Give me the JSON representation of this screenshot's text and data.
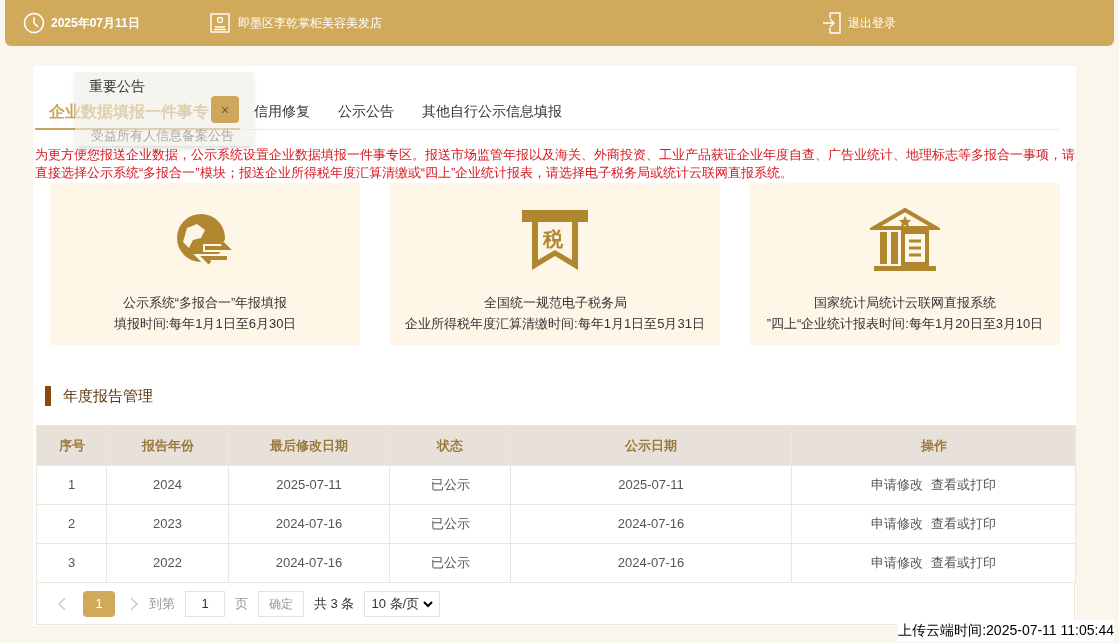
{
  "header": {
    "date": "2025年07月11日",
    "shop": "即墨区李乾掌柜美容美发店",
    "logout": "退出登录"
  },
  "tabs": [
    {
      "label": "企业数据填报一件事专",
      "selected": true
    },
    {
      "label": "信用修复",
      "selected": false
    },
    {
      "label": "公示公告",
      "selected": false
    },
    {
      "label": "其他自行公示信息填报",
      "selected": false
    }
  ],
  "popup": {
    "title": "重要公告",
    "item": "受益所有人信息备案公告",
    "close": "×"
  },
  "notice": "为更方便您报送企业数据，公示系统设置企业数据填报一件事专区。报送市场监管年报以及海关、外商投资、工业产品获证企业年度自查、广告业统计、地理标志等多报合一事项，请直接选择公示系统“多报合一”模块；报送企业所得税年度汇算清缴或“四上”企业统计报表，请选择电子税务局或统计云联网直报系统。",
  "cards": [
    {
      "kind": "globe",
      "title": "公示系统“多报合一”年报填报",
      "time": "填报时间:每年1月1日至6月30日"
    },
    {
      "kind": "tax",
      "title": "全国统一规范电子税务局",
      "time": "企业所得税年度汇算清缴时间:每年1月1日至5月31日"
    },
    {
      "kind": "bank",
      "title": "国家统计局统计云联网直报系统",
      "time": "”四上“企业统计报表时间:每年1月20日至3月10日"
    }
  ],
  "tax_glyph": "税",
  "section_title": "年度报告管理",
  "table": {
    "columns": [
      "序号",
      "报告年份",
      "最后修改日期",
      "状态",
      "公示日期",
      "操作"
    ],
    "rows": [
      {
        "cells": [
          "1",
          "2024",
          "2025-07-11",
          "已公示",
          "2025-07-11"
        ],
        "actions": [
          "申请修改",
          "查看或打印"
        ]
      },
      {
        "cells": [
          "2",
          "2023",
          "2024-07-16",
          "已公示",
          "2024-07-16"
        ],
        "actions": [
          "申请修改",
          "查看或打印"
        ]
      },
      {
        "cells": [
          "3",
          "2022",
          "2024-07-16",
          "已公示",
          "2024-07-16"
        ],
        "actions": [
          "申请修改",
          "查看或打印"
        ]
      }
    ]
  },
  "pagination": {
    "pages": [
      {
        "label": "1",
        "selected": true
      }
    ],
    "goto": "到第",
    "page_value": "1",
    "page_unit": "页",
    "confirm": "确定",
    "total": "共 3 条",
    "page_size": "10 条/页"
  },
  "upload_time": "上传云端时间:2025-07-11 11:05:44"
}
